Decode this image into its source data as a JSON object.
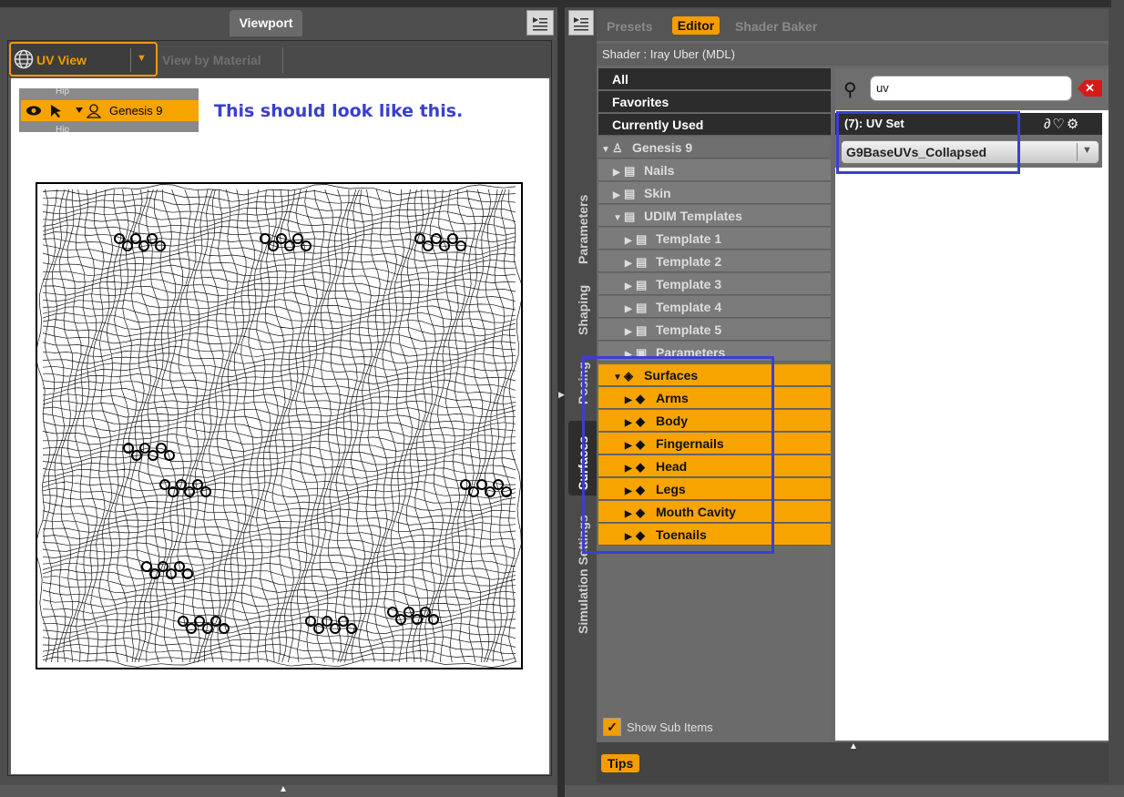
{
  "viewport": {
    "tab_label": "Viewport",
    "view_mode_label": "UV View",
    "view_by_material_label": "View by Material"
  },
  "inset": {
    "node_label": "Genesis 9",
    "note": "This should look like this."
  },
  "surfaces_pane": {
    "side_tabs": [
      "Parameters",
      "Shaping",
      "Posing",
      "Surfaces",
      "Simulation Settings"
    ],
    "top_tabs": {
      "presets": "Presets",
      "editor": "Editor",
      "shader_baker": "Shader Baker"
    },
    "shader": "Shader : Iray Uber (MDL)",
    "filters": [
      "All",
      "Favorites",
      "Currently Used"
    ],
    "tree": {
      "root": "Genesis 9",
      "groups": [
        "Nails",
        "Skin",
        "UDIM Templates"
      ],
      "templates": [
        "Template 1",
        "Template 2",
        "Template 3",
        "Template 4",
        "Template 5"
      ],
      "parameters": "Parameters",
      "surfaces": "Surfaces",
      "surface_items": [
        "Arms",
        "Body",
        "Fingernails",
        "Head",
        "Legs",
        "Mouth Cavity",
        "Toenails"
      ]
    },
    "show_sub_items": "Show Sub Items",
    "search_value": "uv",
    "property_header": "(7): UV Set",
    "uv_set_value": "G9BaseUVs_Collapsed",
    "tips_label": "Tips"
  },
  "colors": {
    "accent": "#f7a400",
    "highlight": "#3b3fd1"
  }
}
